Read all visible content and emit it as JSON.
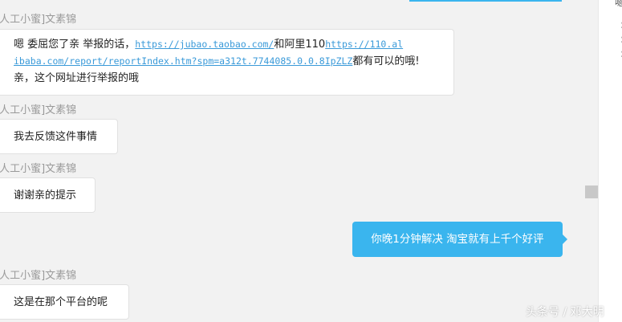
{
  "messages": [
    {
      "sender": "[人工小蜜]文素锦",
      "text_before": "嗯 委屈您了亲    举报的话，",
      "link1": "https://jubao.taobao.com/",
      "text_mid": "和阿里110",
      "link2_line1": "https://110.al",
      "link2_line2": "ibaba.com/report/reportIndex.htm?spm=a312t.7744085.0.0.8IpZLZ",
      "text_after": "都有可以的哦!",
      "line3": "亲，这个网址进行举报的哦"
    },
    {
      "sender": "[人工小蜜]文素锦",
      "text": "我去反馈这件事情"
    },
    {
      "sender": "[人工小蜜]文素锦",
      "text": "谢谢亲的提示"
    },
    {
      "sender": "[人工小蜜]文素锦",
      "text": "这是在那个平台的呢"
    }
  ],
  "outgoing": {
    "text": "你晚1分钟解决 淘宝就有上千个好评"
  },
  "right_pane": {
    "text": "嗯",
    "dots": [
      ":",
      ":",
      ":"
    ]
  },
  "watermark": "头条号 / 邓大明",
  "colors": {
    "outgoing_bubble": "#3ab5ee",
    "link": "#3a9ad9",
    "background": "#f2f2f2"
  }
}
